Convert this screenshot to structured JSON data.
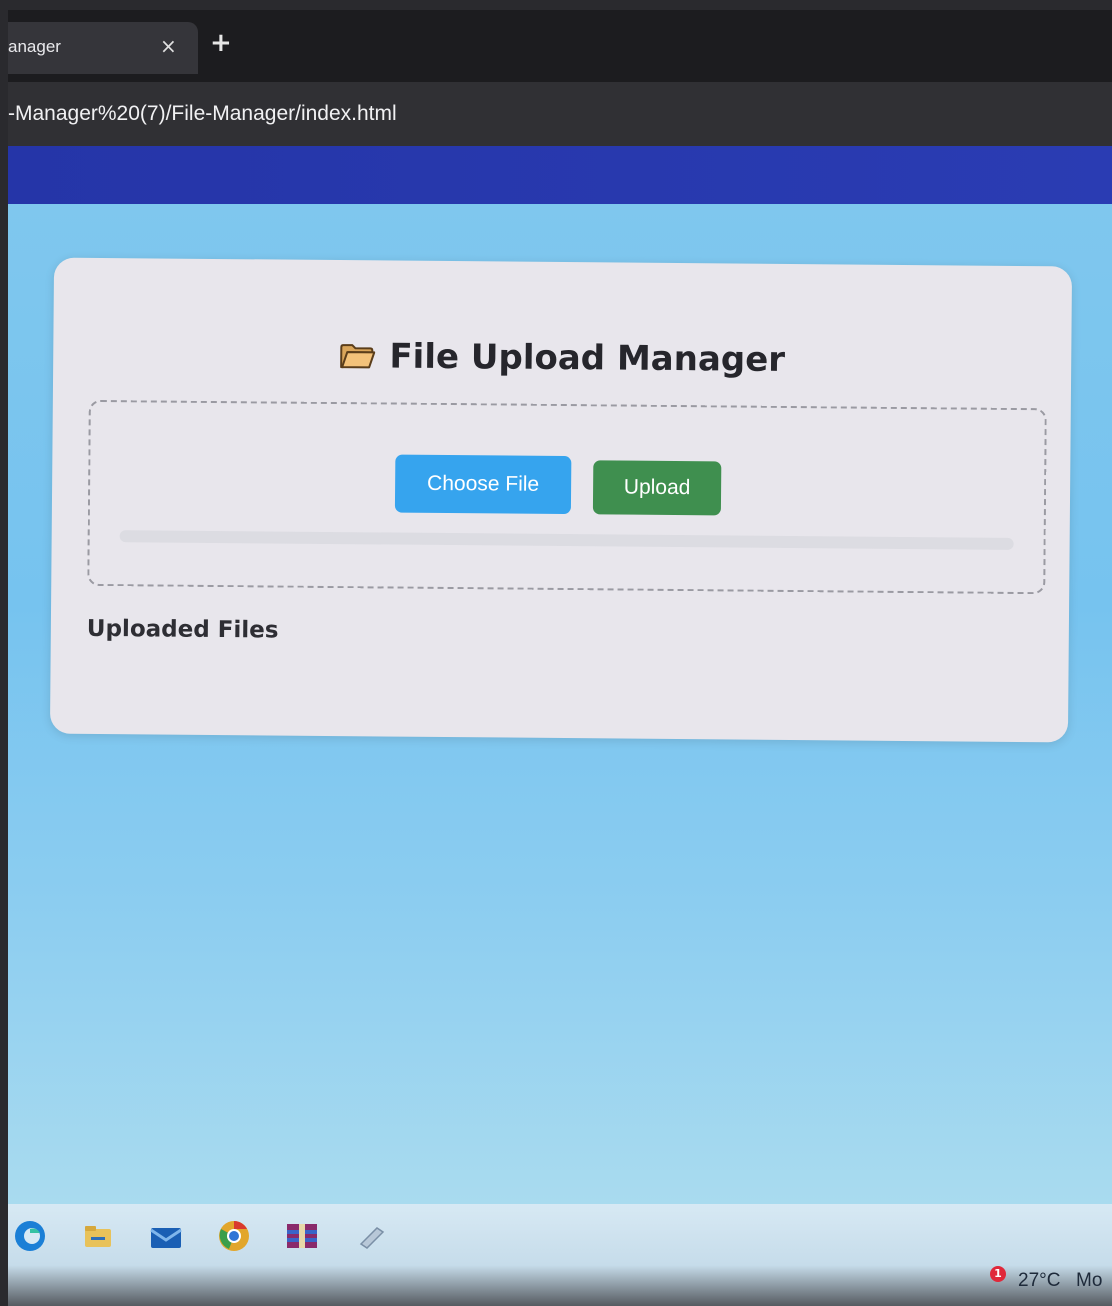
{
  "browser": {
    "tab_title": "anager",
    "tab_close": "×",
    "new_tab": "+",
    "url": "-Manager%20(7)/File-Manager/index.html"
  },
  "card": {
    "title": "File Upload Manager",
    "folder_icon": "folder-icon",
    "choose_file_label": "Choose File",
    "upload_label": "Upload",
    "progress": 0,
    "uploaded_heading": "Uploaded Files"
  },
  "taskbar": {
    "icons": [
      "edge-icon",
      "file-explorer-icon",
      "mail-icon",
      "chrome-icon",
      "winrar-icon",
      "app-icon"
    ],
    "notification_count": "1",
    "weather_temp": "27°C",
    "weather_status": "Mo"
  },
  "colors": {
    "header": "#2a3cb3",
    "background": "#7fc7ee",
    "choose_button": "#36a4ee",
    "upload_button": "#3f8f4f"
  }
}
